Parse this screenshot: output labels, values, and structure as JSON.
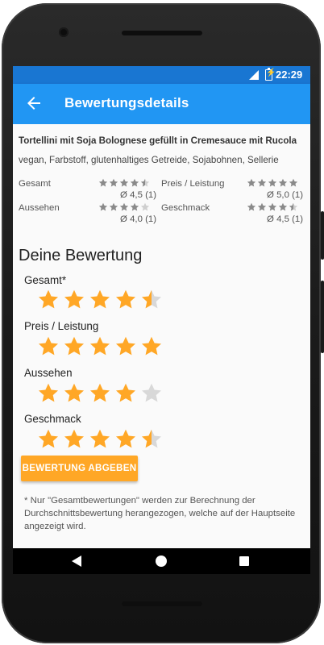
{
  "status_bar": {
    "network": "4G",
    "time": "22:29"
  },
  "app_bar": {
    "title": "Bewertungsdetails",
    "back_icon": "arrow-back-icon"
  },
  "dish": {
    "name": "Tortellini mit Soja Bolognese gefüllt in Cremesauce mit Rucola",
    "tags": "vegan, Farbstoff, glutenhaltiges Getreide, Sojabohnen, Sellerie"
  },
  "summary": [
    {
      "label": "Gesamt",
      "rating": 4.5,
      "avg": "Ø 4,5 (1)"
    },
    {
      "label": "Preis / Leistung",
      "rating": 5.0,
      "avg": "Ø 5,0 (1)"
    },
    {
      "label": "Aussehen",
      "rating": 4.0,
      "avg": "Ø 4,0 (1)"
    },
    {
      "label": "Geschmack",
      "rating": 4.5,
      "avg": "Ø 4,5 (1)"
    }
  ],
  "your_rating": {
    "title": "Deine Bewertung",
    "items": [
      {
        "label": "Gesamt*",
        "rating": 4.5
      },
      {
        "label": "Preis / Leistung",
        "rating": 5
      },
      {
        "label": "Aussehen",
        "rating": 4
      },
      {
        "label": "Geschmack",
        "rating": 4.5
      }
    ]
  },
  "submit_label": "BEWERTUNG ABGEBEN",
  "note": "* Nur \"Gesamtbewertungen\" werden zur Berechnung der Durchschnittsbewertung herangezogen, welche auf der Hauptseite angezeigt wird.",
  "colors": {
    "primary": "#2196f3",
    "primary_dark": "#1976d2",
    "accent": "#ffa726",
    "star_small": "#8a8a8a",
    "star_large": "#ffa726",
    "star_empty": "#d8d8d8"
  },
  "nav_bar": {
    "back_icon": "nav-back-icon",
    "home_icon": "nav-home-icon",
    "recents_icon": "nav-recents-icon"
  }
}
